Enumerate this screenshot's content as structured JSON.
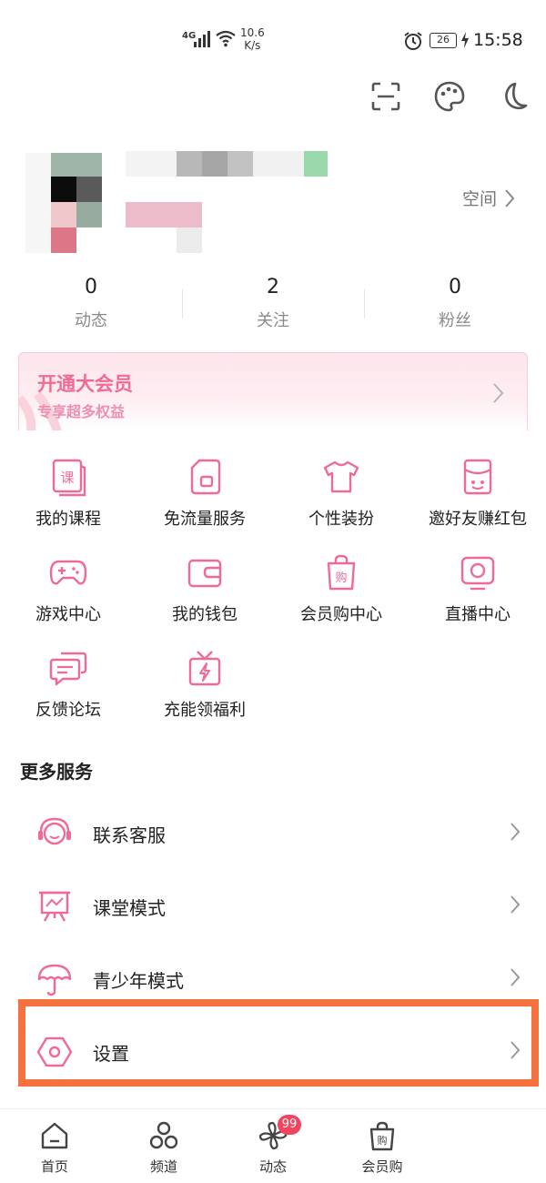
{
  "status_bar": {
    "network": "4G",
    "speed_value": "10.6",
    "speed_unit": "K/s",
    "battery": "26",
    "time": "15:58"
  },
  "top_icons": [
    "scan-icon",
    "palette-icon",
    "moon-icon"
  ],
  "profile": {
    "space_label": "空间"
  },
  "stats": [
    {
      "value": "0",
      "label": "动态"
    },
    {
      "value": "2",
      "label": "关注"
    },
    {
      "value": "0",
      "label": "粉丝"
    }
  ],
  "vip": {
    "title": "开通大会员",
    "subtitle": "专享超多权益"
  },
  "services": [
    {
      "label": "我的课程",
      "icon": "course-book-icon"
    },
    {
      "label": "免流量服务",
      "icon": "sim-card-icon"
    },
    {
      "label": "个性装扮",
      "icon": "tshirt-icon"
    },
    {
      "label": "邀好友赚红包",
      "icon": "red-packet-icon"
    },
    {
      "label": "游戏中心",
      "icon": "gamepad-icon"
    },
    {
      "label": "我的钱包",
      "icon": "wallet-icon"
    },
    {
      "label": "会员购中心",
      "icon": "shopping-bag-icon"
    },
    {
      "label": "直播中心",
      "icon": "live-tv-icon"
    },
    {
      "label": "反馈论坛",
      "icon": "chat-bubbles-icon"
    },
    {
      "label": "充能领福利",
      "icon": "gift-bolt-icon"
    }
  ],
  "more_services": {
    "title": "更多服务",
    "items": [
      {
        "label": "联系客服",
        "icon": "headset-icon"
      },
      {
        "label": "课堂模式",
        "icon": "classroom-board-icon"
      },
      {
        "label": "青少年模式",
        "icon": "umbrella-icon"
      },
      {
        "label": "设置",
        "icon": "settings-hex-icon"
      }
    ]
  },
  "bottom_nav": [
    {
      "label": "首页",
      "icon": "home-icon"
    },
    {
      "label": "频道",
      "icon": "channels-icon"
    },
    {
      "label": "动态",
      "icon": "pinwheel-icon",
      "badge": "99"
    },
    {
      "label": "会员购",
      "icon": "shopping-bag-icon"
    }
  ],
  "colors": {
    "accent_pink": "#ef6b96",
    "highlight_orange": "#f5723e",
    "badge_red": "#f0445f"
  }
}
